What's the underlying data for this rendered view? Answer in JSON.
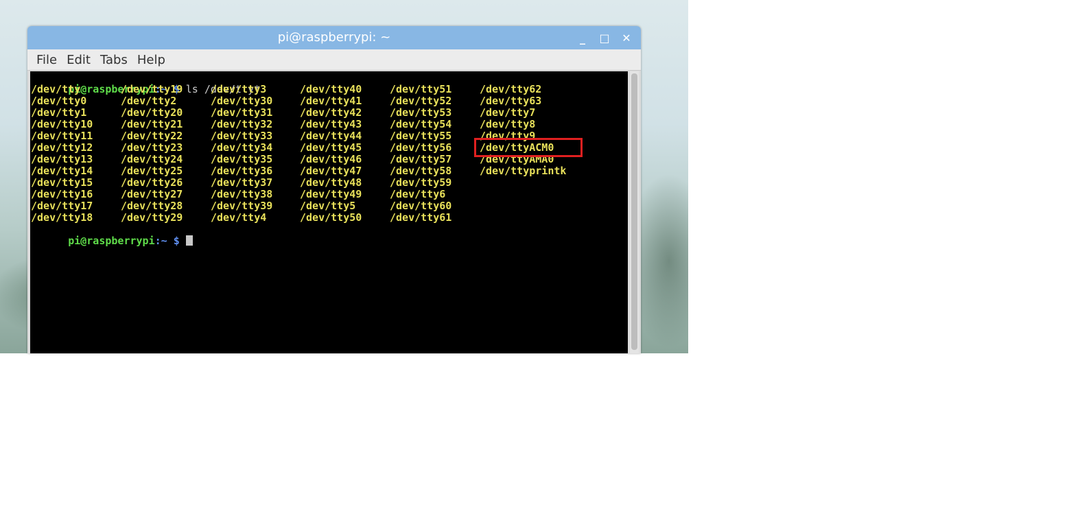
{
  "window": {
    "title": "pi@raspberrypi: ~",
    "controls": {
      "minimize": "_",
      "maximize": "□",
      "close": "✕"
    }
  },
  "menubar": [
    "File",
    "Edit",
    "Tabs",
    "Help"
  ],
  "terminal": {
    "prompt_user": "pi@raspberrypi",
    "prompt_path": ":~",
    "prompt_symbol": " $",
    "command": " ls /dev/tty*",
    "columns": [
      [
        "/dev/tty",
        "/dev/tty0",
        "/dev/tty1",
        "/dev/tty10",
        "/dev/tty11",
        "/dev/tty12",
        "/dev/tty13",
        "/dev/tty14",
        "/dev/tty15",
        "/dev/tty16",
        "/dev/tty17",
        "/dev/tty18"
      ],
      [
        "/dev/tty19",
        "/dev/tty2",
        "/dev/tty20",
        "/dev/tty21",
        "/dev/tty22",
        "/dev/tty23",
        "/dev/tty24",
        "/dev/tty25",
        "/dev/tty26",
        "/dev/tty27",
        "/dev/tty28",
        "/dev/tty29"
      ],
      [
        "/dev/tty3",
        "/dev/tty30",
        "/dev/tty31",
        "/dev/tty32",
        "/dev/tty33",
        "/dev/tty34",
        "/dev/tty35",
        "/dev/tty36",
        "/dev/tty37",
        "/dev/tty38",
        "/dev/tty39",
        "/dev/tty4"
      ],
      [
        "/dev/tty40",
        "/dev/tty41",
        "/dev/tty42",
        "/dev/tty43",
        "/dev/tty44",
        "/dev/tty45",
        "/dev/tty46",
        "/dev/tty47",
        "/dev/tty48",
        "/dev/tty49",
        "/dev/tty5",
        "/dev/tty50"
      ],
      [
        "/dev/tty51",
        "/dev/tty52",
        "/dev/tty53",
        "/dev/tty54",
        "/dev/tty55",
        "/dev/tty56",
        "/dev/tty57",
        "/dev/tty58",
        "/dev/tty59",
        "/dev/tty6",
        "/dev/tty60",
        "/dev/tty61"
      ],
      [
        "/dev/tty62",
        "/dev/tty63",
        "/dev/tty7",
        "/dev/tty8",
        "/dev/tty9",
        "/dev/ttyACM0",
        "/dev/ttyAMA0",
        "/dev/ttyprintk"
      ]
    ],
    "highlighted_device": "/dev/ttyACM0"
  },
  "colors": {
    "titlebar": "#88b7e4",
    "file_text": "#e8e05a",
    "prompt_user": "#5fdc4a",
    "prompt_symbol": "#5f8ff0",
    "highlight_box": "#e02020"
  }
}
